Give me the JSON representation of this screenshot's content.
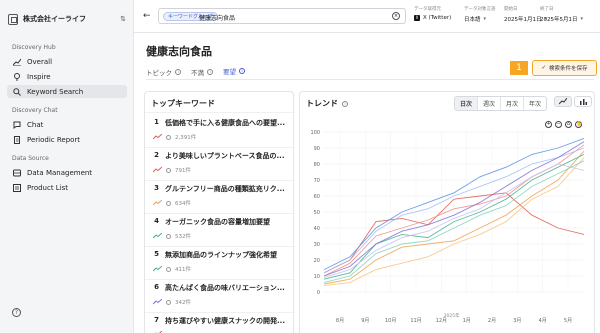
{
  "org": {
    "name": "株式会社イーライフ"
  },
  "sidebar": {
    "sections": [
      {
        "title": "Discovery Hub",
        "items": [
          {
            "label": "Overall",
            "icon": "chart-line-icon"
          },
          {
            "label": "Inspire",
            "icon": "bulb-icon"
          },
          {
            "label": "Keyword Search",
            "icon": "search-icon",
            "active": true
          }
        ]
      },
      {
        "title": "Discovery Chat",
        "items": [
          {
            "label": "Chat",
            "icon": "chat-icon"
          },
          {
            "label": "Periodic Report",
            "icon": "document-icon"
          }
        ]
      },
      {
        "title": "Data Source",
        "items": [
          {
            "label": "Data Management",
            "icon": "database-icon"
          },
          {
            "label": "Product List",
            "icon": "list-icon"
          }
        ]
      }
    ]
  },
  "topbar": {
    "search_chip": "キーワードグループ",
    "query": "健康志向食品",
    "filters": [
      {
        "label": "データ取得元",
        "value": "X (Twitter)"
      },
      {
        "label": "データ対象言語",
        "value": "日本語"
      },
      {
        "label": "開始日",
        "value": "2025年1月1日"
      },
      {
        "label": "終了日",
        "value": "2025年5月1日"
      }
    ]
  },
  "page": {
    "title": "健康志向食品",
    "tabs": [
      {
        "label": "トピック",
        "active": false
      },
      {
        "label": "不満",
        "active": false
      },
      {
        "label": "要望",
        "active": true
      }
    ],
    "step_badge": "1",
    "save_button": "検索条件を保存"
  },
  "keywords": {
    "title": "トップキーワード",
    "items": [
      {
        "rank": "1",
        "text": "低価格で手に入る健康食品への要望...",
        "count": "2,391件",
        "trend_color": "#e05a4f"
      },
      {
        "rank": "2",
        "text": "より美味しいプラントベース食品の...",
        "count": "791件",
        "trend_color": "#e05a4f"
      },
      {
        "rank": "3",
        "text": "グルテンフリー商品の種類拡充リク...",
        "count": "634件",
        "trend_color": "#f0a04b"
      },
      {
        "rank": "4",
        "text": "オーガニック食品の容量増加要望",
        "count": "532件",
        "trend_color": "#43b08a"
      },
      {
        "rank": "5",
        "text": "無添加商品のラインナップ強化希望",
        "count": "411件",
        "trend_color": "#43b08a"
      },
      {
        "rank": "6",
        "text": "高たんぱく食品の味バリエーション...",
        "count": "342件",
        "trend_color": "#7b6fd6"
      },
      {
        "rank": "7",
        "text": "持ち運びやすい健康スナックの開発...",
        "count": "",
        "trend_color": "#e05a4f"
      }
    ]
  },
  "trend": {
    "title": "トレンド",
    "ranges": [
      {
        "label": "日次",
        "active": true
      },
      {
        "label": "週次",
        "active": false
      },
      {
        "label": "月次",
        "active": false
      },
      {
        "label": "年次",
        "active": false
      }
    ]
  },
  "chart_data": {
    "type": "line",
    "x": [
      "8月",
      "9月",
      "10月",
      "11月",
      "12月",
      "1月",
      "2月",
      "3月",
      "4月",
      "5月"
    ],
    "x_annotation": {
      "at": "1月",
      "text": "2025年"
    },
    "ylim": [
      0,
      100
    ],
    "yticks": [
      0,
      10,
      20,
      30,
      40,
      50,
      60,
      70,
      80,
      90,
      100
    ],
    "grid": true,
    "series": [
      {
        "color": "#e05a4f",
        "values": [
          12,
          20,
          44,
          46,
          42,
          58,
          60,
          62,
          48,
          40,
          36
        ]
      },
      {
        "color": "#f28c82",
        "values": [
          10,
          18,
          35,
          40,
          45,
          52,
          55,
          60,
          72,
          80,
          92
        ]
      },
      {
        "color": "#f0a04b",
        "values": [
          5,
          8,
          20,
          28,
          30,
          32,
          40,
          48,
          60,
          70,
          88
        ]
      },
      {
        "color": "#f6c47a",
        "values": [
          4,
          6,
          14,
          18,
          22,
          30,
          36,
          44,
          58,
          66,
          84
        ]
      },
      {
        "color": "#43b08a",
        "values": [
          8,
          12,
          30,
          36,
          34,
          44,
          50,
          58,
          70,
          78,
          86
        ]
      },
      {
        "color": "#7fd4b6",
        "values": [
          6,
          10,
          24,
          30,
          32,
          40,
          48,
          54,
          66,
          74,
          82
        ]
      },
      {
        "color": "#5b8de6",
        "values": [
          14,
          22,
          40,
          50,
          56,
          62,
          72,
          78,
          86,
          90,
          96
        ]
      },
      {
        "color": "#9fbdf0",
        "values": [
          12,
          20,
          38,
          48,
          52,
          60,
          66,
          72,
          80,
          84,
          90
        ]
      },
      {
        "color": "#7b6fd6",
        "values": [
          10,
          16,
          30,
          38,
          42,
          48,
          56,
          66,
          76,
          84,
          94
        ]
      },
      {
        "color": "#c7bff0",
        "values": [
          9,
          14,
          26,
          34,
          38,
          46,
          52,
          62,
          72,
          80,
          76
        ]
      }
    ]
  }
}
